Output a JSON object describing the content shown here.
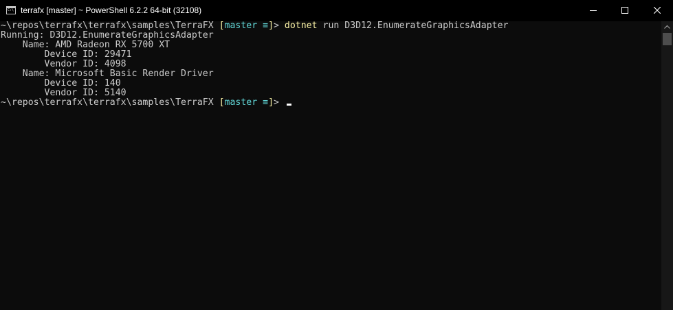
{
  "window": {
    "title": "terrafx [master] ~ PowerShell 6.2.2 64-bit (32108)"
  },
  "icons": {
    "app": "console-icon",
    "minimize": "minimize-icon",
    "maximize": "maximize-icon",
    "close": "close-icon",
    "scroll_up": "chevron-up-icon"
  },
  "colors": {
    "background": "#0c0c0c",
    "foreground": "#cccccc",
    "command": "#f9f1a5",
    "branch_bracket": "#61d6d6"
  },
  "terminal": {
    "prompt1": {
      "path": "~\\repos\\terrafx\\terrafx\\samples\\TerraFX ",
      "open_bracket": "[",
      "branch": "master ",
      "status": "≡",
      "close_bracket": "]",
      "gt": "> ",
      "command": "dotnet",
      "args": " run D3D12.EnumerateGraphicsAdapter"
    },
    "output": [
      "Running: D3D12.EnumerateGraphicsAdapter",
      "    Name: AMD Radeon RX 5700 XT",
      "        Device ID: 29471",
      "        Vendor ID: 4098",
      "    Name: Microsoft Basic Render Driver",
      "        Device ID: 140",
      "        Vendor ID: 5140"
    ],
    "prompt2": {
      "path": "~\\repos\\terrafx\\terrafx\\samples\\TerraFX ",
      "open_bracket": "[",
      "branch": "master ",
      "status": "≡",
      "close_bracket": "]",
      "gt": "> "
    }
  }
}
